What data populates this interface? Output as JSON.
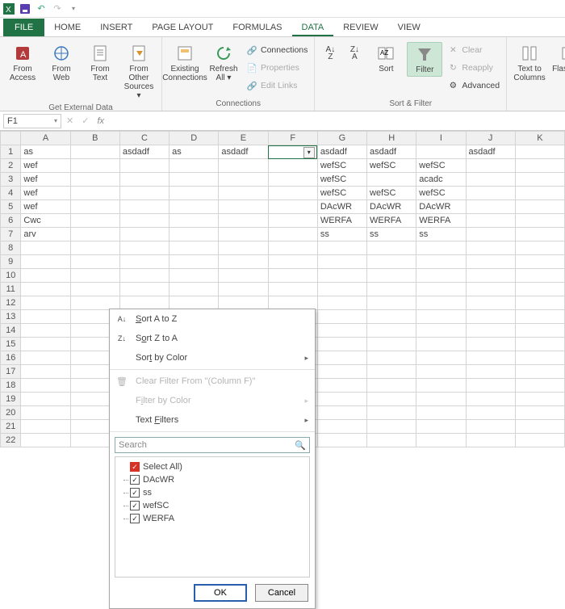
{
  "qat": {
    "excel": "X",
    "save": "💾",
    "undo": "↶",
    "redo": "↷"
  },
  "tabs": [
    "FILE",
    "HOME",
    "INSERT",
    "PAGE LAYOUT",
    "FORMULAS",
    "DATA",
    "REVIEW",
    "VIEW"
  ],
  "active_tab": "DATA",
  "ribbon": {
    "ext_data": {
      "label": "Get External Data",
      "btns": [
        "From Access",
        "From Web",
        "From Text",
        "From Other Sources ▾"
      ]
    },
    "connections": {
      "label": "Connections",
      "btns": [
        "Existing Connections",
        "Refresh All ▾"
      ],
      "mini": [
        "Connections",
        "Properties",
        "Edit Links"
      ]
    },
    "sortfilter": {
      "label": "Sort & Filter",
      "sort": "Sort",
      "filter": "Filter",
      "mini": [
        "Clear",
        "Reapply",
        "Advanced"
      ]
    },
    "tools": {
      "cols": "Text to Columns",
      "fill": "Flash Fill"
    }
  },
  "name_ref": "F1",
  "cols": [
    "A",
    "B",
    "C",
    "D",
    "E",
    "F",
    "G",
    "H",
    "I",
    "J",
    "K"
  ],
  "rows": [
    {
      "n": 1,
      "A": "as",
      "C": "asdadf",
      "D": "as",
      "E": "asdadf",
      "G": "asdadf",
      "H": "asdadf",
      "J": "asdadf"
    },
    {
      "n": 2,
      "A": "wef",
      "G": "wefSC",
      "H": "wefSC",
      "I": "wefSC"
    },
    {
      "n": 3,
      "A": "wef",
      "G": "wefSC",
      "I": "acadc"
    },
    {
      "n": 4,
      "A": "wef",
      "G": "wefSC",
      "H": "wefSC",
      "I": "wefSC"
    },
    {
      "n": 5,
      "A": "wef",
      "G": "DAcWR",
      "H": "DAcWR",
      "I": "DAcWR"
    },
    {
      "n": 6,
      "A": "Cwc",
      "G": "WERFA",
      "H": "WERFA",
      "I": "WERFA"
    },
    {
      "n": 7,
      "A": "arv",
      "G": "ss",
      "H": "ss",
      "I": "ss"
    },
    {
      "n": 8
    },
    {
      "n": 9
    },
    {
      "n": 10
    },
    {
      "n": 11
    },
    {
      "n": 12
    },
    {
      "n": 13
    },
    {
      "n": 14
    },
    {
      "n": 15
    },
    {
      "n": 16
    },
    {
      "n": 17
    },
    {
      "n": 18
    },
    {
      "n": 19
    },
    {
      "n": 20
    },
    {
      "n": 21
    },
    {
      "n": 22
    }
  ],
  "menu": {
    "sort_az": "Sort A to Z",
    "sort_za": "Sort Z to A",
    "sort_color": "Sort by Color",
    "clear": "Clear Filter From \"(Column F)\"",
    "filter_color": "Filter by Color",
    "text_filters": "Text Filters",
    "search": "Search",
    "items": [
      "Select All)",
      "DAcWR",
      "ss",
      "wefSC",
      "WERFA"
    ],
    "ok": "OK",
    "cancel": "Cancel"
  }
}
